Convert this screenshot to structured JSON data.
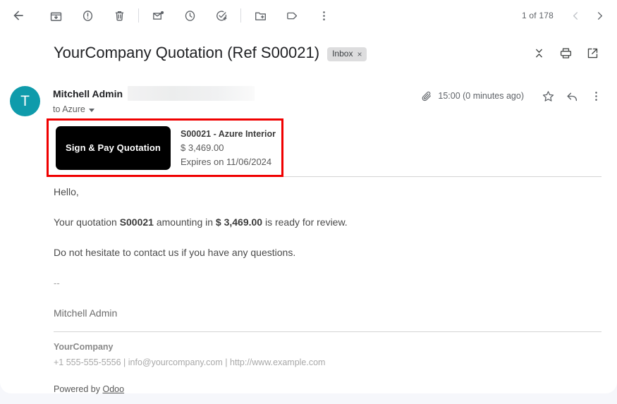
{
  "toolbar": {
    "icons": [
      {
        "name": "back-arrow-icon",
        "label": "Back to Inbox"
      },
      {
        "name": "archive-icon",
        "label": "Archive"
      },
      {
        "name": "report-spam-icon",
        "label": "Report spam"
      },
      {
        "name": "delete-icon",
        "label": "Delete"
      },
      {
        "name": "mark-unread-icon",
        "label": "Mark as unread"
      },
      {
        "name": "snooze-icon",
        "label": "Snooze"
      },
      {
        "name": "add-to-tasks-icon",
        "label": "Add to tasks"
      },
      {
        "name": "move-to-icon",
        "label": "Move to"
      },
      {
        "name": "labels-icon",
        "label": "Labels"
      },
      {
        "name": "more-options-icon",
        "label": "More"
      }
    ],
    "pagination": "1 of 178",
    "prev_label": "Older",
    "next_label": "Newer"
  },
  "subject": {
    "title": "YourCompany Quotation (Ref S00021)",
    "chip_label": "Inbox",
    "chip_close": "×",
    "actions": [
      {
        "name": "collapse-all-icon",
        "label": "Collapse all"
      },
      {
        "name": "print-icon",
        "label": "Print all"
      },
      {
        "name": "open-new-window-icon",
        "label": "In new window"
      }
    ]
  },
  "message": {
    "avatar_initial": "T",
    "avatar_color": "#0f9bab",
    "sender_name": "Mitchell Admin",
    "recipient_line": "to Azure",
    "timestamp": "15:00 (0 minutes ago)",
    "has_attachment": true,
    "actions": [
      {
        "name": "star-icon",
        "label": "Star"
      },
      {
        "name": "reply-icon",
        "label": "Reply"
      },
      {
        "name": "message-more-icon",
        "label": "More"
      }
    ]
  },
  "quotation": {
    "button_label": "Sign & Pay Quotation",
    "reference_title": "S00021 - Azure Interior",
    "amount": "$ 3,469.00",
    "expiry": "Expires on 11/06/2024",
    "highlight_color": "#f00000",
    "button_color": "#000000"
  },
  "body": {
    "greeting": "Hello,",
    "line2_pre": "Your quotation ",
    "line2_ref": "S00021",
    "line2_mid": " amounting in ",
    "line2_amount": "$ 3,469.00",
    "line2_post": " is ready for review.",
    "line3": "Do not hesitate to contact us if you have any questions.",
    "signature_dashes": "--",
    "signature_name": "Mitchell Admin"
  },
  "footer": {
    "company": "YourCompany",
    "contact": "+1 555-555-5556 | info@yourcompany.com | http://www.example.com",
    "powered_prefix": "Powered by ",
    "powered_link": "Odoo"
  }
}
